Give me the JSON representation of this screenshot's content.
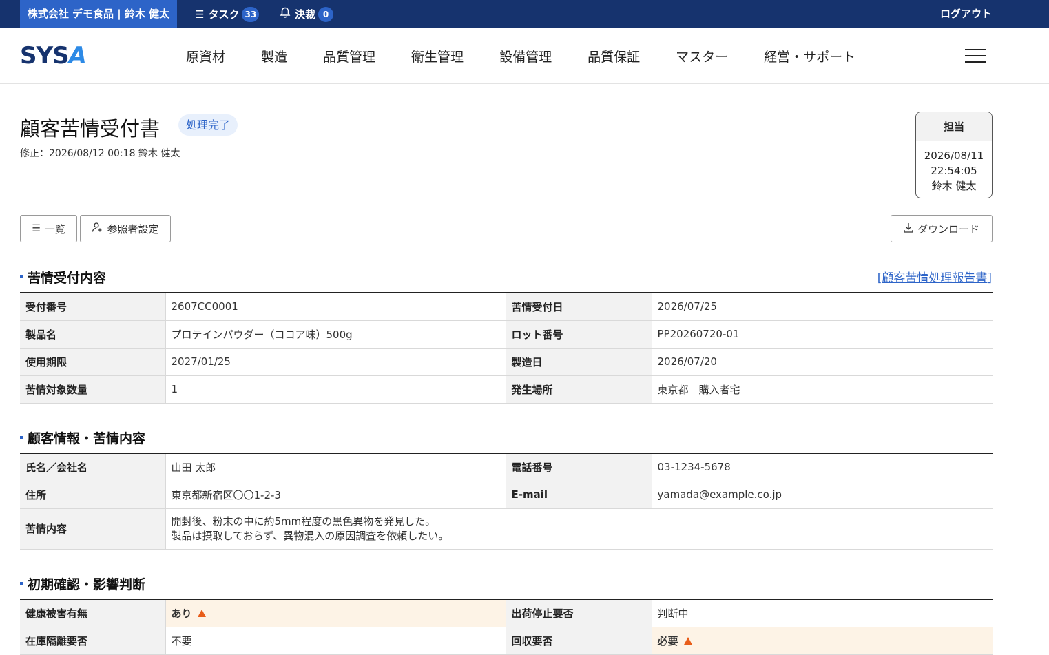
{
  "topbar": {
    "company_user": "株式会社 デモ食品 | 鈴木 健太",
    "tasks_label": "タスク",
    "tasks_count": "33",
    "approvals_label": "決裁",
    "approvals_count": "0",
    "logout": "ログアウト",
    "colors": {
      "bar": "#16336e",
      "company_bg": "#2d64c8",
      "badge": "#2d64c8"
    }
  },
  "header": {
    "logo_text_1": "SYS",
    "logo_text_2": "A",
    "nav": [
      "原資材",
      "製造",
      "品質管理",
      "衛生管理",
      "設備管理",
      "品質保証",
      "マスター",
      "経営・サポート"
    ],
    "menu_icon": "hamburger-icon"
  },
  "document": {
    "title": "顧客苦情受付書",
    "status": "処理完了",
    "modified": "修正：2026/08/12 00:18 鈴木 健太",
    "assignee": {
      "header": "担当",
      "date": "2026/08/11",
      "time": "22:54:05",
      "name": "鈴木 健太"
    }
  },
  "buttons": {
    "list": "一覧",
    "list_icon": "list-icon",
    "viewers": "参照者設定",
    "viewers_icon": "user-add-icon",
    "download": "ダウンロード",
    "download_icon": "download-icon"
  },
  "sections": {
    "complaint": {
      "title": "苦情受付内容",
      "link": "[顧客苦情処理報告書]",
      "rows": [
        [
          "受付番号",
          "2607CC0001",
          "苦情受付日",
          "2026/07/25"
        ],
        [
          "製品名",
          "プロテインパウダー（ココア味）500g",
          "ロット番号",
          "PP20260720-01"
        ],
        [
          "使用期限",
          "2027/01/25",
          "製造日",
          "2026/07/20"
        ],
        [
          "苦情対象数量",
          "1",
          "発生場所",
          "東京都　購入者宅"
        ]
      ]
    },
    "customer": {
      "title": "顧客情報・苦情内容",
      "rows": [
        [
          "氏名／会社名",
          "山田 太郎",
          "電話番号",
          "03-1234-5678"
        ],
        [
          "住所",
          "東京都新宿区〇〇1-2-3",
          "E-mail",
          "yamada@example.co.jp"
        ]
      ],
      "content_label": "苦情内容",
      "content_line1": "開封後、粉末の中に約5mm程度の黒色異物を発見した。",
      "content_line2": "製品は摂取しておらず、異物混入の原因調査を依頼したい。"
    },
    "initial": {
      "title": "初期確認・影響判断",
      "rows": [
        [
          "健康被害有無",
          "あり",
          "出荷停止要否",
          "判断中"
        ],
        [
          "在庫隔離要否",
          "不要",
          "回収要否",
          "必要"
        ]
      ],
      "warning_color": "#e85d1a"
    }
  }
}
